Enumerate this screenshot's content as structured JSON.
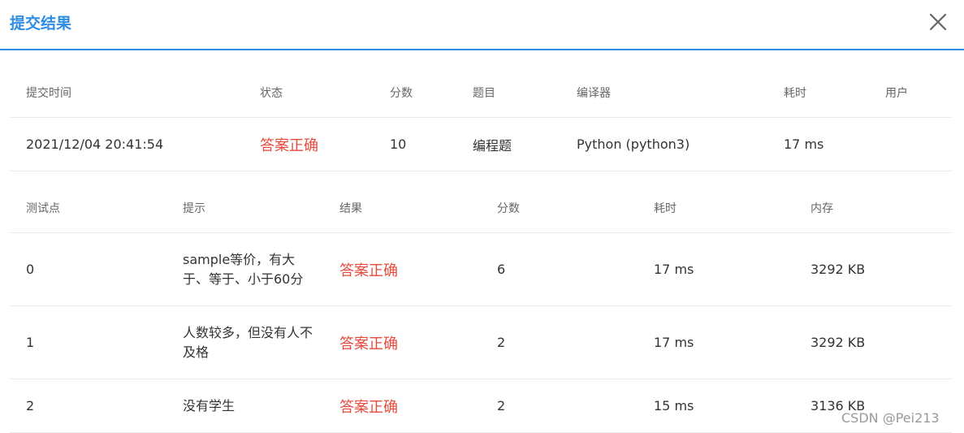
{
  "dialog": {
    "title": "提交结果"
  },
  "submission": {
    "headers": [
      "提交时间",
      "状态",
      "分数",
      "题目",
      "编译器",
      "耗时",
      "用户"
    ],
    "row": {
      "time": "2021/12/04 20:41:54",
      "status": "答案正确",
      "score": "10",
      "problem": "编程题",
      "compiler": "Python (python3)",
      "elapsed": "17 ms"
    }
  },
  "tests": {
    "headers": [
      "测试点",
      "提示",
      "结果",
      "分数",
      "耗时",
      "内存"
    ],
    "rows": [
      {
        "id": "0",
        "hint": "sample等价，有大于、等于、小于60分",
        "result": "答案正确",
        "score": "6",
        "elapsed": "17 ms",
        "memory": "3292 KB"
      },
      {
        "id": "1",
        "hint": "人数较多，但没有人不及格",
        "result": "答案正确",
        "score": "2",
        "elapsed": "17 ms",
        "memory": "3292 KB"
      },
      {
        "id": "2",
        "hint": "没有学生",
        "result": "答案正确",
        "score": "2",
        "elapsed": "15 ms",
        "memory": "3136 KB"
      }
    ]
  },
  "watermark": "CSDN @Pei213",
  "colors": {
    "accent": "#2f8de4",
    "correct": "#e84a3c"
  }
}
